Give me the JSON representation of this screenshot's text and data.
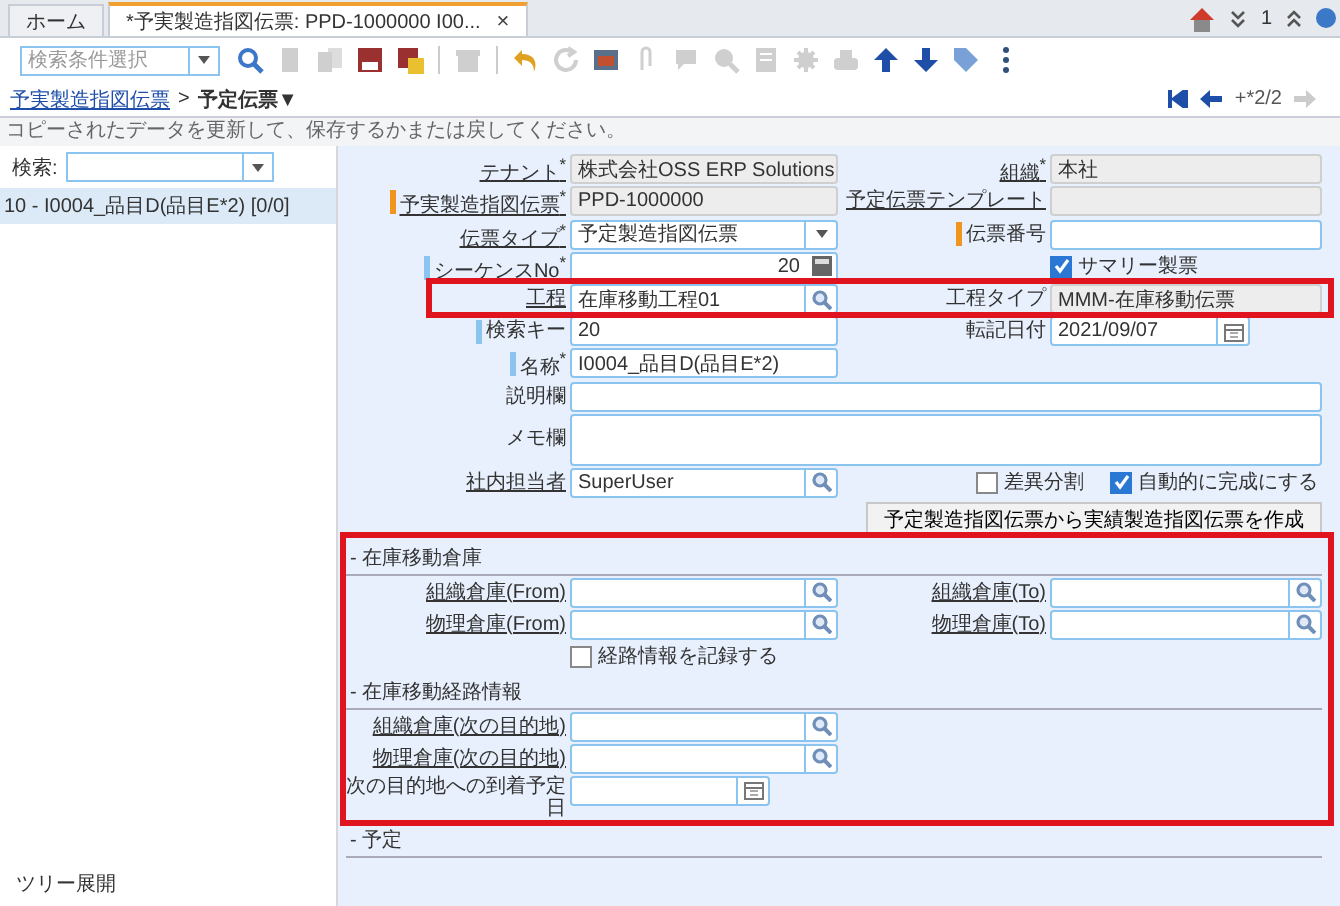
{
  "tabs": [
    {
      "label": "ホーム",
      "selected": false
    },
    {
      "label": "*予実製造指図伝票: PPD-1000000 I00...",
      "selected": true,
      "close": "×"
    }
  ],
  "header": {
    "counter": "1"
  },
  "toolbar": {
    "search_placeholder": "検索条件選択",
    "buttons": [
      {
        "disabled": false
      },
      {
        "disabled": true
      },
      {
        "disabled": true
      },
      {
        "disabled": false
      },
      {
        "disabled": false
      },
      {
        "disabled": true
      },
      {
        "disabled": false
      },
      {
        "disabled": true
      },
      {
        "disabled": false
      },
      {
        "disabled": true
      },
      {
        "disabled": true
      },
      {
        "disabled": true
      },
      {
        "disabled": true
      },
      {
        "disabled": true
      },
      {
        "disabled": true
      },
      {
        "disabled": false
      },
      {
        "disabled": false
      },
      {
        "disabled": false
      },
      {
        "disabled": false
      }
    ]
  },
  "breadcrumb": {
    "parent": "予実製造指図伝票",
    "separator": ">",
    "current": "予定伝票▼",
    "record": "+*2/2",
    "nav": [
      {
        "disabled": false
      },
      {
        "disabled": false
      },
      {
        "disabled": true
      }
    ]
  },
  "message": "コピーされたデータを更新して、保存するかまたは戻してください。",
  "tree": {
    "search_label": "検索:",
    "items": [
      {
        "label": "10 - I0004_品目D(品目E*2) [0/0]",
        "selected": true
      }
    ],
    "footer": "ツリー展開"
  },
  "form": {
    "rows": [
      {
        "left": {
          "kind": "text",
          "label": "テナント$^{*}$",
          "link": true,
          "readonly": true,
          "value": "株式会社OSS ERP Solutions"
        },
        "right": {
          "kind": "text",
          "label": "組織$^{*}$",
          "link": true,
          "readonly": true,
          "value": "本社"
        }
      },
      {
        "left": {
          "kind": "text",
          "label": "予実製造指図伝票$^{*}$",
          "link": true,
          "readonly": true,
          "color": "#f0961e",
          "value": "PPD-1000000"
        },
        "right": {
          "kind": "text",
          "label": "予定伝票テンプレート",
          "link": true,
          "readonly": true
        }
      },
      {
        "left": {
          "kind": "select",
          "label": "伝票タイプ$^{*}$",
          "link": true,
          "readonly": false,
          "value": "予定製造指図伝票"
        },
        "right": {
          "kind": "text",
          "label": "伝票番号",
          "link": false,
          "readonly": false,
          "color": "#f0961e"
        }
      },
      {
        "left": {
          "kind": "number",
          "label": "シーケンスNo$^{*}$",
          "link": false,
          "readonly": false,
          "color": "#8cc4f0",
          "value": "20"
        },
        "right": {
          "kind": "checkbox",
          "label": "サマリー製票",
          "checked": true
        }
      },
      {
        "highlighted": true,
        "left": {
          "kind": "lookup",
          "label": "工程",
          "link": true,
          "readonly": false,
          "value": "在庫移動工程01"
        },
        "right": {
          "kind": "text",
          "label": "工程タイプ",
          "link": false,
          "readonly": true,
          "value": "MMM-在庫移動伝票"
        }
      },
      {
        "left": {
          "kind": "text",
          "label": "検索キー",
          "link": false,
          "readonly": false,
          "color": "#8cc4f0",
          "value": "20"
        },
        "right": {
          "kind": "date",
          "label": "転記日付",
          "link": false,
          "readonly": false,
          "value": "2021/09/07"
        }
      },
      {
        "left": {
          "kind": "text",
          "label": "名称$^{*}$",
          "link": false,
          "readonly": false,
          "color": "#8cc4f0",
          "value": "I0004_品目D(品目E*2)"
        }
      },
      {
        "left": {
          "kind": "longtext",
          "label": "説明欄",
          "link": false,
          "readonly": false
        }
      },
      {
        "left": {
          "kind": "memo",
          "label": "メモ欄",
          "link": false,
          "readonly": false
        }
      },
      {
        "left": {
          "kind": "lookup",
          "label": "社内担当者",
          "link": true,
          "readonly": false,
          "value": "SuperUser"
        },
        "right": {
          "kind": "checks",
          "items": [
            {
              "label": "差異分割",
              "checked": false
            },
            {
              "label": "自動的に完成にする",
              "checked": true
            }
          ]
        }
      }
    ],
    "button": "予定製造指図伝票から実績製造指図伝票を作成",
    "panels": [
      {
        "highlighted": true,
        "sections": [
          {
            "title": "- 在庫移動倉庫",
            "rows": [
              {
                "left": {
                  "kind": "lookup",
                  "label": "組織倉庫(From)",
                  "link": true,
                  "readonly": false
                },
                "right": {
                  "kind": "lookup",
                  "label": "組織倉庫(To)",
                  "link": true,
                  "readonly": false
                }
              },
              {
                "left": {
                  "kind": "lookup",
                  "label": "物理倉庫(From)",
                  "link": true,
                  "readonly": false
                },
                "right": {
                  "kind": "lookup",
                  "label": "物理倉庫(To)",
                  "link": true,
                  "readonly": false
                }
              },
              {
                "left": {
                  "kind": "checkbox",
                  "label": "経路情報を記録する",
                  "checked": false
                }
              }
            ]
          },
          {
            "title": "- 在庫移動経路情報",
            "rows": [
              {
                "left": {
                  "kind": "lookup",
                  "label": "組織倉庫(次の目的地)",
                  "link": true,
                  "readonly": false
                }
              },
              {
                "left": {
                  "kind": "lookup",
                  "label": "物理倉庫(次の目的地)",
                  "link": true,
                  "readonly": false
                }
              },
              {
                "left": {
                  "kind": "date",
                  "label": "次の目的地への到着予定日",
                  "link": false,
                  "readonly": false
                }
              }
            ]
          }
        ]
      },
      {
        "highlighted": false,
        "sections": [
          {
            "title": "- 予定"
          }
        ]
      }
    ]
  }
}
